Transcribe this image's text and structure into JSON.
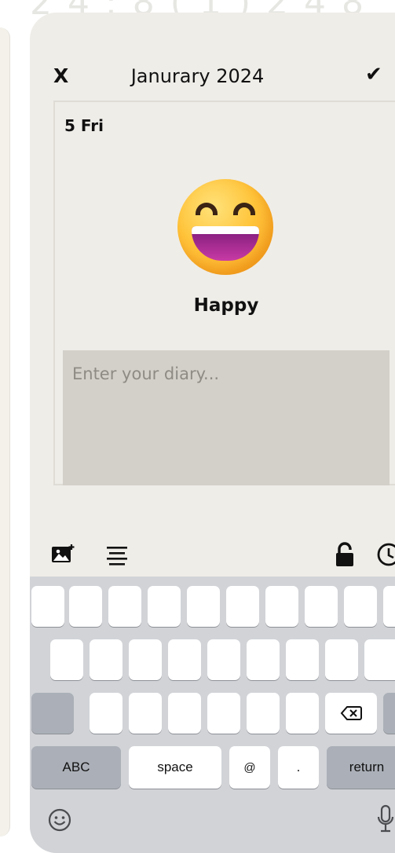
{
  "header_fragment": "2 4 : 8 ( 1 ) 2 4 8",
  "topbar": {
    "close_label": "X",
    "month_title": "Janurary 2024",
    "confirm_label": "✔"
  },
  "entry": {
    "date_label": "5 Fri",
    "emoji_name": "grinning-face-with-smiling-eyes-icon",
    "mood_label": "Happy",
    "diary_placeholder": "Enter your diary...",
    "diary_value": ""
  },
  "toolbar": {
    "icons": [
      "add-photo-icon",
      "text-align-icon",
      "lock-icon",
      "clock-icon"
    ]
  },
  "keyboard": {
    "abc_label": "ABC",
    "space_label": "space",
    "at_label": "@",
    "period_label": ".",
    "return_label": "return"
  },
  "colors": {
    "background": "#efede8",
    "input_fill": "#d3d0c9",
    "keyboard_bg": "#d1d3d7"
  }
}
